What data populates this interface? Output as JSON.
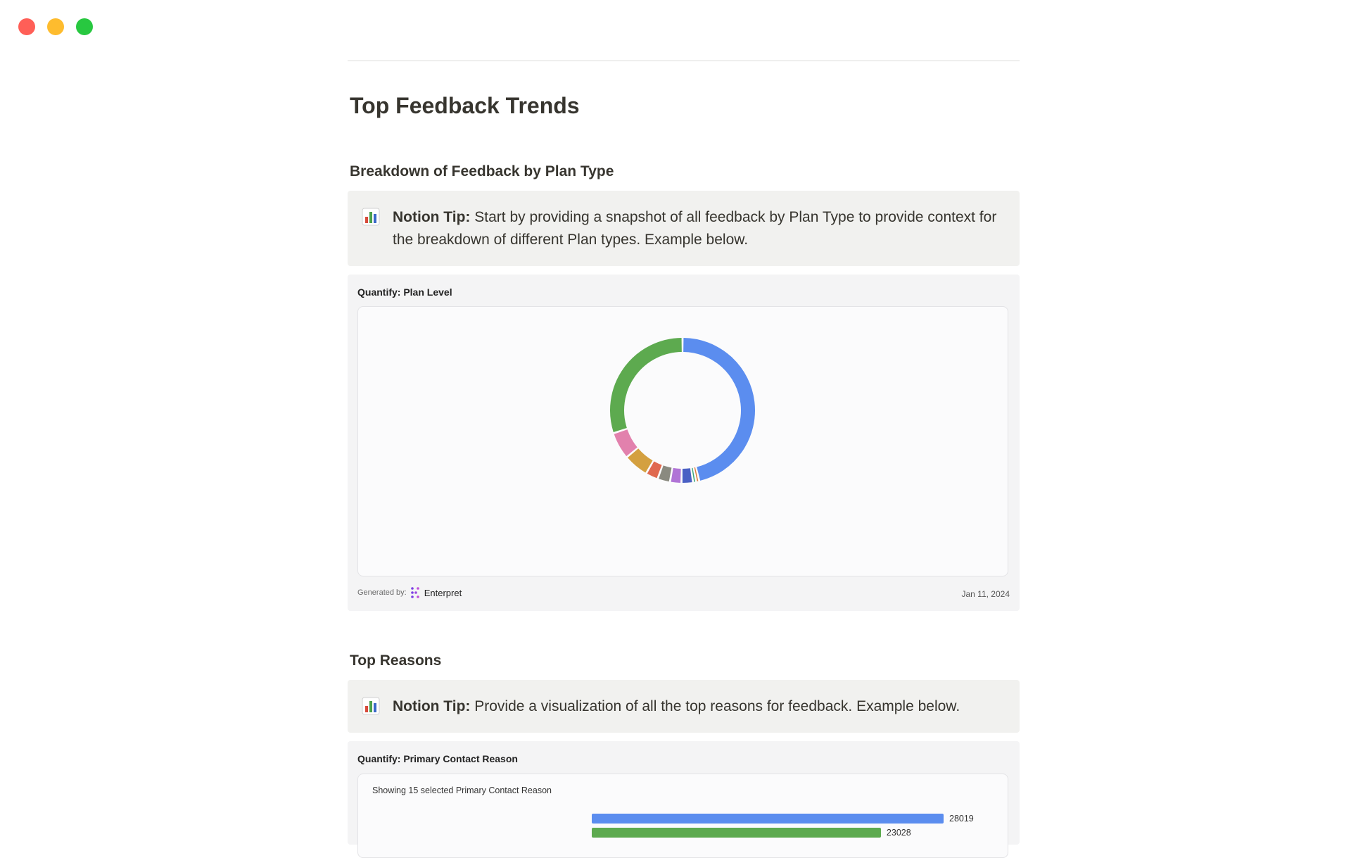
{
  "window": {
    "controls": [
      "close",
      "minimize",
      "zoom"
    ]
  },
  "page": {
    "title": "Top Feedback Trends"
  },
  "section1": {
    "heading": "Breakdown of Feedback by Plan Type",
    "callout": {
      "icon": "bar-chart-icon",
      "bold": "Notion Tip:",
      "text": " Start by providing a snapshot of all feedback by Plan Type to provide context for the breakdown of different Plan types. Example below."
    },
    "embed": {
      "title": "Quantify: Plan Level",
      "generated_by": "Generated by:",
      "brand": "Enterpret",
      "date": "Jan 11, 2024"
    }
  },
  "section2": {
    "heading": "Top Reasons",
    "callout": {
      "icon": "bar-chart-icon",
      "bold": "Notion Tip:",
      "text": " Provide a visualization of all the top reasons for feedback. Example below."
    },
    "embed": {
      "title": "Quantify: Primary Contact Reason",
      "subtitle": "Showing 15 selected Primary Contact Reason"
    }
  },
  "chart_data": [
    {
      "type": "pie",
      "variant": "donut",
      "title": "",
      "slices": [
        {
          "value": 40,
          "color": "#5b8def"
        },
        {
          "value": 0.6,
          "color": "#e07b39"
        },
        {
          "value": 0.6,
          "color": "#3aa87a"
        },
        {
          "value": 2.2,
          "color": "#4a60c4"
        },
        {
          "value": 2.2,
          "color": "#b074d6"
        },
        {
          "value": 2.4,
          "color": "#8a8a80"
        },
        {
          "value": 2.4,
          "color": "#e0694f"
        },
        {
          "value": 4.8,
          "color": "#d4a040"
        },
        {
          "value": 5.2,
          "color": "#e281ad"
        },
        {
          "value": 26,
          "color": "#5daa4f"
        }
      ]
    },
    {
      "type": "bar",
      "orientation": "horizontal",
      "values": [
        28019,
        23028
      ],
      "colors": [
        "#5b8def",
        "#5daa4f"
      ],
      "xlim": [
        0,
        28019
      ]
    }
  ]
}
